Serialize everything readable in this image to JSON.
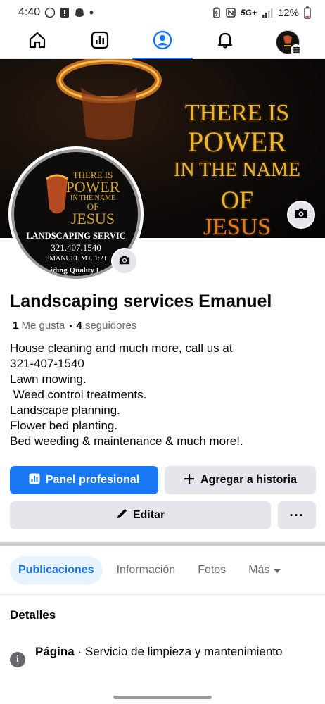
{
  "status_bar": {
    "time": "4:40",
    "network": "5G+",
    "battery": "12%"
  },
  "nav": {
    "items": [
      "home",
      "dashboard",
      "profile",
      "notifications",
      "menu"
    ],
    "active": "profile"
  },
  "cover": {
    "line1": "THERE IS",
    "line2": "POWER",
    "line3": "IN THE NAME",
    "line4": "OF",
    "line5": "JESUS"
  },
  "profile_pic": {
    "line1": "THERE IS",
    "line2": "POWER",
    "line3": "IN THE NAME",
    "line4": "OF",
    "line5": "JESUS",
    "line6": "LANDSCAPING SERVIC",
    "line7": "321.407.1540",
    "line8": "EMANUEL MT. 1:21",
    "line9": "iding Quality L"
  },
  "page": {
    "name": "Landscaping services Emanuel",
    "likes_count": "1",
    "likes_label": "Me gusta",
    "separator": "•",
    "followers_count": "4",
    "followers_label": "seguidores",
    "bio": "House cleaning and much more, call us at\n321-407-1540\nLawn mowing.\n Weed control treatments.\nLandscape planning.\nFlower bed planting.\nBed weeding & maintenance & much more!."
  },
  "actions": {
    "panel_label": "Panel profesional",
    "story_label": "Agregar a historia",
    "edit_label": "Editar",
    "more_label": "···"
  },
  "tabs": [
    {
      "label": "Publicaciones",
      "active": true
    },
    {
      "label": "Información",
      "active": false
    },
    {
      "label": "Fotos",
      "active": false
    },
    {
      "label": "Más",
      "active": false
    }
  ],
  "details": {
    "title": "Detalles",
    "category_label": "Página",
    "category_sep": " · ",
    "category_value": "Servicio de limpieza y mantenimiento",
    "info_icon": "i"
  },
  "colors": {
    "accent": "#1877f2",
    "button_gray": "#e4e6eb",
    "secondary_text": "#65676b",
    "cover_gold": "#e8b630"
  }
}
